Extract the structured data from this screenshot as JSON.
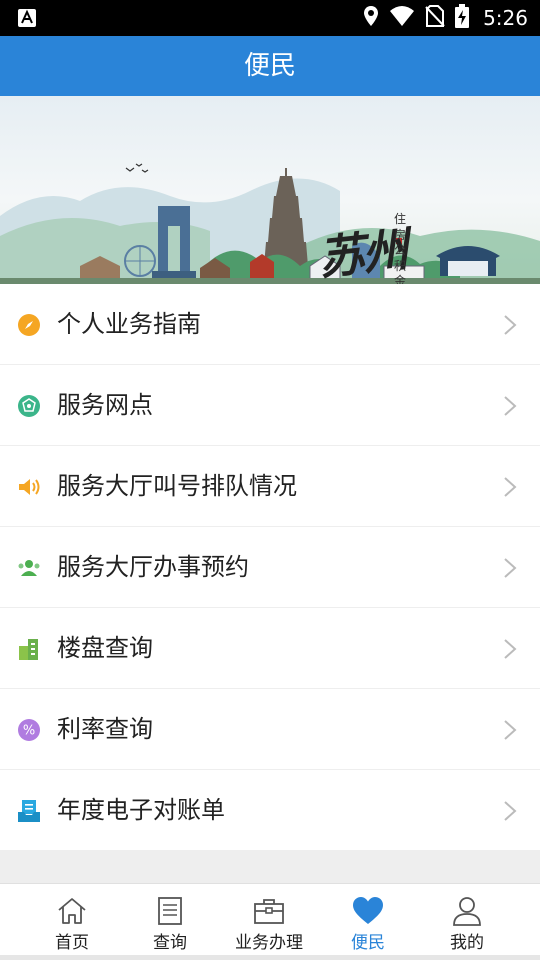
{
  "status_bar": {
    "time": "5:26",
    "icons": [
      "font-a-icon",
      "location-icon",
      "wifi-icon",
      "no-sim-icon",
      "battery-charging-icon"
    ]
  },
  "header": {
    "title": "便民"
  },
  "banner": {
    "title_chars": [
      "苏",
      "州"
    ],
    "subtitle": "住房公积金管理中心"
  },
  "menu": {
    "items": [
      {
        "label": "个人业务指南",
        "icon": "compass-icon",
        "color": "#f5a623"
      },
      {
        "label": "服务网点",
        "icon": "network-icon",
        "color": "#3bb58a"
      },
      {
        "label": "服务大厅叫号排队情况",
        "icon": "speaker-icon",
        "color": "#f5a623"
      },
      {
        "label": "服务大厅办事预约",
        "icon": "people-icon",
        "color": "#4caf50"
      },
      {
        "label": "楼盘查询",
        "icon": "building-icon",
        "color": "#6ab04c"
      },
      {
        "label": "利率查询",
        "icon": "percent-icon",
        "color": "#a66bd8"
      },
      {
        "label": "年度电子对账单",
        "icon": "statement-icon",
        "color": "#29a8e0"
      }
    ]
  },
  "bottom_nav": {
    "items": [
      {
        "label": "首页",
        "icon": "home-icon",
        "active": false
      },
      {
        "label": "查询",
        "icon": "document-icon",
        "active": false
      },
      {
        "label": "业务办理",
        "icon": "briefcase-icon",
        "active": false
      },
      {
        "label": "便民",
        "icon": "heart-icon",
        "active": true
      },
      {
        "label": "我的",
        "icon": "user-icon",
        "active": false
      }
    ]
  },
  "colors": {
    "primary": "#2a84d8",
    "divider": "#eeeeee",
    "text": "#222222",
    "chevron": "#bbbbbb"
  }
}
